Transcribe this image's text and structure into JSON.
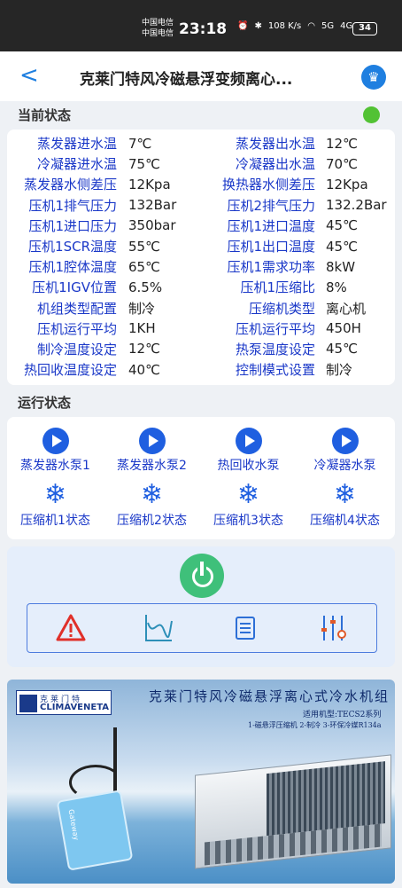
{
  "statusbar": {
    "carrier1": "中国电信",
    "carrier2": "中国电信",
    "time": "23:18",
    "net_speed": "108 K/s",
    "net1": "5G",
    "net2": "4G",
    "battery": "34"
  },
  "header": {
    "title": "克莱门特风冷磁悬浮变频离心..."
  },
  "sections": {
    "current_status": "当前状态",
    "run_status": "运行状态"
  },
  "colors": {
    "accent": "#1f7fe0",
    "label_blue": "#1a38c8",
    "status_ok": "#52c234",
    "power_green": "#3fc07a"
  },
  "params": [
    {
      "l1": "蒸发器进水温",
      "v1": "7℃",
      "l2": "蒸发器出水温",
      "v2": "12℃"
    },
    {
      "l1": "冷凝器进水温",
      "v1": "75℃",
      "l2": "冷凝器出水温",
      "v2": "70℃"
    },
    {
      "l1": "蒸发器水侧差压",
      "v1": "12Kpa",
      "l2": "换热器水侧差压",
      "v2": "12Kpa"
    },
    {
      "l1": "压机1排气压力",
      "v1": "132Bar",
      "l2": "压机2排气压力",
      "v2": "132.2Bar"
    },
    {
      "l1": "压机1进口压力",
      "v1": "350bar",
      "l2": "压机1进口温度",
      "v2": "45℃"
    },
    {
      "l1": "压机1SCR温度",
      "v1": "55℃",
      "l2": "压机1出口温度",
      "v2": "45℃"
    },
    {
      "l1": "压机1腔体温度",
      "v1": "65℃",
      "l2": "压机1需求功率",
      "v2": "8kW"
    },
    {
      "l1": "压机1IGV位置",
      "v1": "6.5%",
      "l2": "压机1压缩比",
      "v2": "8%"
    },
    {
      "l1": "机组类型配置",
      "v1": "制冷",
      "l2": "压缩机类型",
      "v2": "离心机"
    },
    {
      "l1": "压机运行平均",
      "v1": "1KH",
      "l2": "压机运行平均",
      "v2": "450H"
    },
    {
      "l1": "制冷温度设定",
      "v1": "12℃",
      "l2": "热泵温度设定",
      "v2": "45℃"
    },
    {
      "l1": "热回收温度设定",
      "v1": "40℃",
      "l2": "控制模式设置",
      "v2": "制冷"
    }
  ],
  "run_items": [
    {
      "icon": "play-icon",
      "label": "蒸发器水泵1"
    },
    {
      "icon": "play-icon",
      "label": "蒸发器水泵2"
    },
    {
      "icon": "play-icon",
      "label": "热回收水泵"
    },
    {
      "icon": "play-icon",
      "label": "冷凝器水泵"
    },
    {
      "icon": "snowflake-icon",
      "label": "压缩机1状态"
    },
    {
      "icon": "snowflake-icon",
      "label": "压缩机2状态"
    },
    {
      "icon": "snowflake-icon",
      "label": "压缩机3状态"
    },
    {
      "icon": "snowflake-icon",
      "label": "压缩机4状态"
    }
  ],
  "toolbar_icons": [
    "alarm-icon",
    "curve-chart-icon",
    "list-icon",
    "settings-sliders-icon"
  ],
  "banner": {
    "logo_cn": "克莱门特",
    "logo_en": "CLIMAVENETA",
    "title": "克莱门特风冷磁悬浮离心式冷水机组",
    "subtitle1": "适用机型:TECS2系列",
    "subtitle2": "1-磁悬浮压缩机 2-制冷 3-环保冷媒R134a",
    "gateway_label": "Gateway"
  }
}
